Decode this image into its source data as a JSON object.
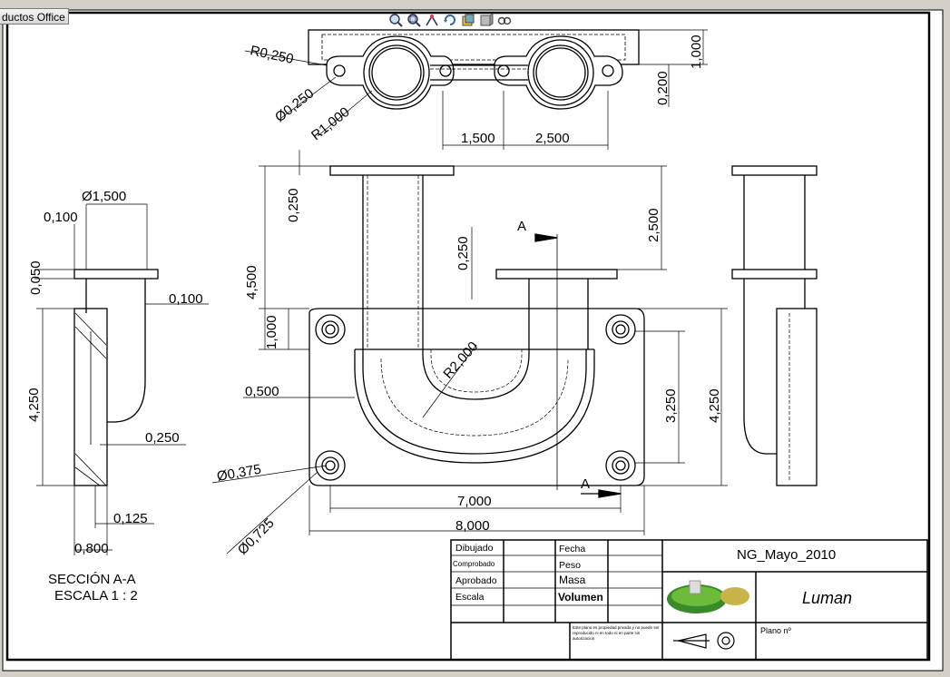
{
  "window": {
    "tab_label": "ductos Office"
  },
  "toolbar": {
    "icons": [
      "zoom-to-fit-icon",
      "zoom-area-icon",
      "view-orientation-icon",
      "rotate-icon",
      "display-style-icon",
      "section-view-icon",
      "hide-show-icon"
    ]
  },
  "drawing": {
    "top_view": {
      "r0250": "R0,250",
      "d0250": "Ø0,250",
      "r1000": "R1,000",
      "d1500": "1,500",
      "d2500": "2,500",
      "d1000": "1,000",
      "d0200": "0,200"
    },
    "front_view": {
      "d0250_top": "0,250",
      "d4500": "4,500",
      "d1000": "1,000",
      "d0250_mid": "0,250",
      "d2500": "2,500",
      "r2000": "R2,000",
      "d0500": "0,500",
      "d3250": "3,250",
      "d4250": "4,250",
      "d7000": "7,000",
      "d8000": "8,000",
      "dia0375": "Ø0,375",
      "dia0725": "Ø0,725",
      "section_a_top": "A",
      "section_a_bottom": "A"
    },
    "section_view": {
      "dia1500": "Ø1,500",
      "d0100_top": "0,100",
      "d0050": "0,050",
      "d0100_right": "0,100",
      "d4250": "4,250",
      "d0250": "0,250",
      "d0125": "0,125",
      "d0800": "0,800",
      "caption_line1": "SECCIÓN A-A",
      "caption_line2": "ESCALA 1 : 2"
    },
    "title_block": {
      "dibujado": "Dibujado",
      "comprobado": "Comprobado",
      "aprobado": "Aprobado",
      "escala": "Escala",
      "fecha": "Fecha",
      "peso": "Peso",
      "masa": "Masa",
      "volumen": "Volumen",
      "title": "NG_Mayo_2010",
      "signature": "Luman",
      "plano": "Plano nº",
      "note": "Este plano es propiedad privada y no puede ser reproducido ni en todo ni en parte sin autorizacion"
    }
  }
}
